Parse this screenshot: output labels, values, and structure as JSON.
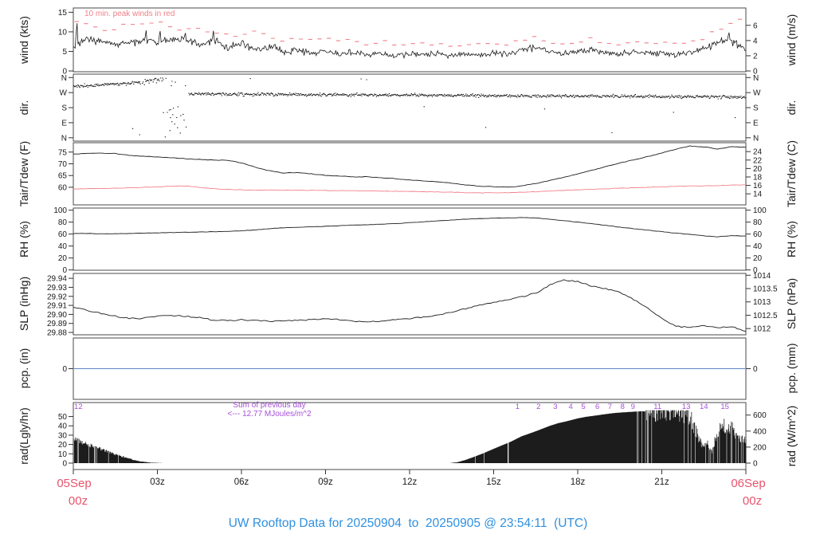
{
  "colors": {
    "data_black": "#1c1c1c",
    "red_series": "#f2808a",
    "date_red": "#e8546c",
    "title_blue": "#2f90e0",
    "purple": "#a64fd8",
    "pcp_blue": "#5e87c8",
    "box_gray": "#4a4a4a",
    "tick_gray": "#333333"
  },
  "chart_data": {
    "type": "multi-panel-timeseries",
    "title": "UW Rooftop Data for 20250904  to  20250905 @ 23:54:11  (UTC)",
    "xaxis": {
      "unit": "hours UTC from 05Sep 00z",
      "range_hours": [
        0,
        24
      ],
      "tick_hours": [
        0,
        3,
        6,
        9,
        12,
        15,
        18,
        21,
        24
      ],
      "tick_labels": [
        "",
        "03z",
        "06z",
        "09z",
        "12z",
        "15z",
        "18z",
        "21z",
        ""
      ],
      "start_label": [
        "05Sep",
        "00z"
      ],
      "end_label": [
        "06Sep",
        "00z"
      ]
    },
    "sample_step_hours": 0.5,
    "panels": [
      {
        "id": "wind",
        "type": "line",
        "ylabel_left": "wind (kts)",
        "ylabel_right": "wind (m/s)",
        "annotation": "10 min. peak winds in red",
        "yticks_left_kts": [
          0,
          5,
          10,
          15
        ],
        "yticks_right_ms": [
          0,
          2,
          4,
          6
        ],
        "ylim_kts": [
          -0.2,
          16.1
        ],
        "mean_kts": [
          6.5,
          8.2,
          7.4,
          6.8,
          7.2,
          7.8,
          7.4,
          7.9,
          8.3,
          6.6,
          7.6,
          5.9,
          6.8,
          5.6,
          6.2,
          5.0,
          5.3,
          4.6,
          5.0,
          4.3,
          4.7,
          4.1,
          4.5,
          3.9,
          4.3,
          4.0,
          4.4,
          3.8,
          4.2,
          4.0,
          4.5,
          4.2,
          5.3,
          5.9,
          4.8,
          4.4,
          4.9,
          5.6,
          4.7,
          4.4,
          5.2,
          4.3,
          4.9,
          4.1,
          4.6,
          5.7,
          7.2,
          7.8,
          5.6
        ],
        "peak_kts": [
          13.0,
          12.4,
          10.3,
          11.0,
          12.3,
          11.6,
          12.5,
          11.2,
          10.6,
          10.9,
          9.9,
          9.2,
          8.8,
          9.9,
          8.6,
          7.7,
          8.8,
          7.9,
          8.3,
          7.4,
          7.8,
          7.0,
          7.5,
          6.8,
          7.2,
          6.7,
          7.3,
          6.6,
          7.0,
          6.6,
          7.2,
          6.8,
          8.0,
          8.6,
          7.4,
          6.9,
          7.6,
          8.3,
          7.2,
          6.8,
          7.9,
          6.8,
          7.4,
          6.6,
          7.0,
          8.3,
          10.6,
          12.6,
          13.6
        ],
        "gust_spikes": [
          [
            0.12,
            12.2
          ],
          [
            2.6,
            10.4
          ],
          [
            3.1,
            10.2
          ],
          [
            4.0,
            9.7
          ],
          [
            5.0,
            10.3
          ],
          [
            16.3,
            6.6
          ],
          [
            23.4,
            9.8
          ]
        ]
      },
      {
        "id": "dir",
        "type": "scatter",
        "ylabel_left": "dir.",
        "ylabel_right": "dir.",
        "yticks_deg": [
          {
            "v": 0,
            "l": "N"
          },
          {
            "v": 90,
            "l": "E"
          },
          {
            "v": 180,
            "l": "S"
          },
          {
            "v": 270,
            "l": "W"
          },
          {
            "v": 360,
            "l": "N"
          }
        ],
        "ylim_deg": [
          -20,
          380.5
        ],
        "segments": [
          {
            "h0": 0.0,
            "h1": 2.4,
            "m0": 308,
            "m1": 330,
            "sd": 9,
            "wrap": false,
            "drop": 0
          },
          {
            "h0": 2.4,
            "h1": 3.3,
            "m0": 330,
            "m1": 356,
            "sd": 14,
            "wrap": true,
            "drop": 0.25
          },
          {
            "h0": 3.3,
            "h1": 4.1,
            "transition": true,
            "drop": 0.5
          },
          {
            "h0": 4.1,
            "h1": 24.0,
            "m0": 262,
            "m1": 243,
            "sd": 8.5,
            "wrap": false,
            "drop": 0
          }
        ],
        "outliers": [
          [
            2.1,
            55
          ],
          [
            2.35,
            18
          ],
          [
            3.2,
            150
          ],
          [
            3.45,
            120
          ],
          [
            3.5,
            96
          ],
          [
            3.6,
            82
          ],
          [
            3.7,
            60
          ],
          [
            3.8,
            28
          ],
          [
            3.9,
            140
          ],
          [
            6.3,
            354
          ],
          [
            10.25,
            352
          ],
          [
            10.45,
            347
          ],
          [
            12.5,
            186
          ],
          [
            14.7,
            62
          ],
          [
            16.8,
            172
          ],
          [
            19.2,
            30
          ],
          [
            21.4,
            152
          ],
          [
            23.6,
            120
          ]
        ]
      },
      {
        "id": "temp",
        "type": "line",
        "ylabel_left": "Tair/Tdew (F)",
        "ylabel_right": "Tair/Tdew (C)",
        "yticks_left_f": [
          60,
          65,
          70,
          75
        ],
        "yticks_right_c": [
          14,
          16,
          18,
          20,
          22,
          24
        ],
        "ylim_f": [
          52.5,
          79.0
        ],
        "tair_f": [
          74.2,
          74.4,
          74.6,
          74.4,
          73.6,
          73.2,
          72.9,
          72.6,
          72.2,
          71.9,
          71.6,
          71.5,
          70.4,
          68.6,
          67.0,
          66.1,
          66.3,
          65.7,
          65.1,
          64.8,
          64.4,
          64.5,
          64.0,
          63.7,
          63.1,
          62.7,
          62.3,
          61.7,
          61.0,
          60.5,
          60.3,
          60.0,
          60.6,
          61.6,
          62.9,
          64.2,
          65.7,
          67.2,
          68.8,
          70.3,
          71.7,
          73.1,
          74.6,
          76.3,
          77.6,
          77.2,
          76.3,
          77.4,
          77.0
        ],
        "tdew_f": [
          59.3,
          59.4,
          59.5,
          59.6,
          59.8,
          60.0,
          60.2,
          60.4,
          60.6,
          60.0,
          59.4,
          59.1,
          58.9,
          58.8,
          58.8,
          58.7,
          58.7,
          58.7,
          58.6,
          58.6,
          58.5,
          58.5,
          58.4,
          58.3,
          58.2,
          58.1,
          58.0,
          57.9,
          57.7,
          57.6,
          57.6,
          57.7,
          57.9,
          58.1,
          58.4,
          58.7,
          58.9,
          59.1,
          59.3,
          59.6,
          59.8,
          60.0,
          60.2,
          60.4,
          60.5,
          60.6,
          60.7,
          60.9,
          61.1
        ]
      },
      {
        "id": "rh",
        "type": "line",
        "ylabel_left": "RH (%)",
        "ylabel_right": "RH (%)",
        "yticks": [
          0,
          20,
          40,
          60,
          80,
          100
        ],
        "ylim_pct": [
          -0.5,
          103.5
        ],
        "rh_pct": [
          61,
          61,
          60.5,
          60.5,
          61,
          61.5,
          62,
          62.5,
          63,
          63.5,
          64,
          64.5,
          65.5,
          67,
          69,
          70.5,
          71,
          72,
          73,
          74,
          75,
          75.5,
          76.5,
          77.5,
          79,
          80.5,
          82,
          83.5,
          85,
          86,
          86.5,
          87,
          87.5,
          87,
          85,
          82.5,
          80,
          77.5,
          74.5,
          71.5,
          69,
          66.5,
          64,
          61.5,
          59.5,
          57,
          55.5,
          57.5,
          56.5
        ]
      },
      {
        "id": "slp",
        "type": "line",
        "ylabel_left": "SLP (inHg)",
        "ylabel_right": "SLP (hPa)",
        "yticks_left_inhg": [
          29.88,
          29.89,
          29.9,
          29.91,
          29.92,
          29.93,
          29.94
        ],
        "yticks_right_hpa": [
          1012,
          1012.5,
          1013,
          1013.5,
          1014
        ],
        "ylim_inhg": [
          29.8774,
          29.9454
        ],
        "slp_inhg": [
          29.908,
          29.9045,
          29.901,
          29.898,
          29.8955,
          29.8955,
          29.8985,
          29.899,
          29.898,
          29.8965,
          29.8935,
          29.8933,
          29.894,
          29.8935,
          29.8925,
          29.8927,
          29.8937,
          29.894,
          29.8955,
          29.8945,
          29.8925,
          29.8915,
          29.8928,
          29.894,
          29.8955,
          29.897,
          29.8995,
          29.9025,
          29.9065,
          29.9105,
          29.9135,
          29.9165,
          29.9195,
          29.9235,
          29.9325,
          29.938,
          29.9365,
          29.9315,
          29.9285,
          29.9245,
          29.9165,
          29.9065,
          29.8955,
          29.8868,
          29.8856,
          29.8872,
          29.8856,
          29.8868,
          29.881
        ]
      },
      {
        "id": "pcp",
        "type": "line",
        "ylabel_left": "pcp. (in)",
        "ylabel_right": "pcp. (mm)",
        "yticks": [
          0
        ],
        "ylim": [
          -1,
          1
        ],
        "value_in": 0
      },
      {
        "id": "rad",
        "type": "bar",
        "ylabel_left": "rad(Lgly/hr)",
        "ylabel_right": "rad (W/m^2)",
        "yticks_left_lgly": [
          0,
          10,
          20,
          30,
          40,
          50
        ],
        "yticks_right_wm2": [
          0,
          200,
          400,
          600
        ],
        "ylim_wm2": [
          -80,
          756
        ],
        "lgly_to_wm2": 11.63,
        "envelope_wm2": [
          [
            0,
            300
          ],
          [
            0.3,
            262
          ],
          [
            0.6,
            225
          ],
          [
            0.9,
            185
          ],
          [
            1.2,
            148
          ],
          [
            1.5,
            110
          ],
          [
            1.8,
            76
          ],
          [
            2.1,
            45
          ],
          [
            2.4,
            22
          ],
          [
            2.7,
            8
          ],
          [
            3,
            3
          ],
          [
            3.3,
            0
          ],
          [
            13.4,
            0
          ],
          [
            13.7,
            10
          ],
          [
            14,
            40
          ],
          [
            14.3,
            78
          ],
          [
            14.6,
            118
          ],
          [
            15,
            178
          ],
          [
            15.3,
            222
          ],
          [
            15.6,
            265
          ],
          [
            16,
            335
          ],
          [
            16.3,
            372
          ],
          [
            16.6,
            410
          ],
          [
            17,
            465
          ],
          [
            17.3,
            498
          ],
          [
            17.6,
            522
          ],
          [
            18,
            558
          ],
          [
            18.3,
            578
          ],
          [
            18.6,
            592
          ],
          [
            19,
            612
          ],
          [
            19.3,
            625
          ],
          [
            19.6,
            633
          ],
          [
            20,
            642
          ],
          [
            20.3,
            648
          ],
          [
            20.6,
            638
          ],
          [
            21,
            648
          ],
          [
            21.3,
            614
          ],
          [
            21.6,
            622
          ],
          [
            21.9,
            590
          ],
          [
            22.1,
            500
          ],
          [
            22.3,
            310
          ],
          [
            22.5,
            175
          ],
          [
            22.6,
            260
          ],
          [
            22.8,
            150
          ],
          [
            23,
            405
          ],
          [
            23.2,
            455
          ],
          [
            23.4,
            442
          ],
          [
            23.6,
            385
          ],
          [
            23.8,
            285
          ],
          [
            24,
            310
          ]
        ],
        "sum_note_line1": "Sum of previous day",
        "sum_note_line2": "<--- 12.77 MJoules/m^2",
        "prev_day_mark": {
          "h": 0.18,
          "label": "12"
        },
        "cum_marks": [
          [
            15.85,
            "1"
          ],
          [
            16.6,
            "2"
          ],
          [
            17.2,
            "3"
          ],
          [
            17.75,
            "4"
          ],
          [
            18.2,
            "5"
          ],
          [
            18.7,
            "6"
          ],
          [
            19.15,
            "7"
          ],
          [
            19.6,
            "8"
          ],
          [
            19.97,
            "9"
          ],
          [
            20.85,
            "11"
          ],
          [
            21.87,
            "13"
          ],
          [
            22.5,
            "14"
          ],
          [
            23.25,
            "15"
          ]
        ]
      }
    ]
  }
}
